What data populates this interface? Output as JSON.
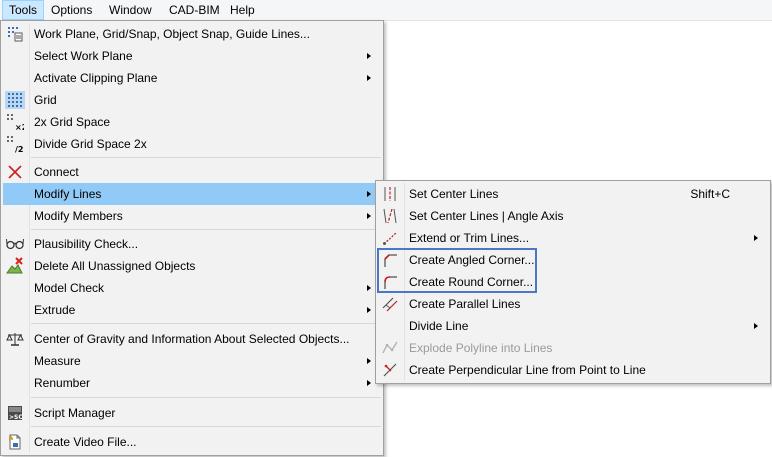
{
  "menubar": {
    "items": [
      "Tools",
      "Options",
      "Window",
      "CAD-BIM",
      "Help"
    ]
  },
  "tools_menu": {
    "items": [
      {
        "label": "Work Plane, Grid/Snap, Object Snap, Guide Lines...",
        "icon": "grid-settings-icon",
        "submenu": false
      },
      {
        "label": "Select Work Plane",
        "icon": "",
        "submenu": true
      },
      {
        "label": "Activate Clipping Plane",
        "icon": "",
        "submenu": true
      },
      {
        "label": "Grid",
        "icon": "grid-icon",
        "submenu": false
      },
      {
        "label": "2x Grid Space",
        "icon": "grid-space-2x-icon",
        "submenu": false
      },
      {
        "label": "Divide Grid Space 2x",
        "icon": "divide-grid-space-icon",
        "submenu": false
      },
      {
        "label": "Connect",
        "icon": "connect-icon",
        "submenu": false
      },
      {
        "label": "Modify Lines",
        "icon": "",
        "submenu": true
      },
      {
        "label": "Modify Members",
        "icon": "",
        "submenu": true
      },
      {
        "label": "Plausibility Check...",
        "icon": "glasses-icon",
        "submenu": false
      },
      {
        "label": "Delete All Unassigned Objects",
        "icon": "delete-objects-icon",
        "submenu": false
      },
      {
        "label": "Model Check",
        "icon": "",
        "submenu": true
      },
      {
        "label": "Extrude",
        "icon": "",
        "submenu": true
      },
      {
        "label": "Center of Gravity and Information About Selected Objects...",
        "icon": "scale-icon",
        "submenu": false
      },
      {
        "label": "Measure",
        "icon": "",
        "submenu": true
      },
      {
        "label": "Renumber",
        "icon": "",
        "submenu": true
      },
      {
        "label": "Script Manager",
        "icon": "script-manager-icon",
        "submenu": false
      },
      {
        "label": "Create Video File...",
        "icon": "video-file-icon",
        "submenu": false
      }
    ]
  },
  "modify_lines_menu": {
    "items": [
      {
        "label": "Set Center Lines",
        "icon": "center-lines-icon",
        "shortcut": "Shift+C",
        "submenu": false
      },
      {
        "label": "Set Center Lines | Angle Axis",
        "icon": "center-lines-angle-icon",
        "shortcut": "",
        "submenu": false
      },
      {
        "label": "Extend or Trim Lines...",
        "icon": "extend-trim-icon",
        "shortcut": "",
        "submenu": true
      },
      {
        "label": "Create Angled Corner...",
        "icon": "angled-corner-icon",
        "shortcut": "",
        "submenu": false
      },
      {
        "label": "Create Round Corner...",
        "icon": "round-corner-icon",
        "shortcut": "",
        "submenu": false
      },
      {
        "label": "Create Parallel Lines",
        "icon": "parallel-lines-icon",
        "shortcut": "",
        "submenu": false
      },
      {
        "label": "Divide Line",
        "icon": "",
        "shortcut": "",
        "submenu": true
      },
      {
        "label": "Explode Polyline into Lines",
        "icon": "explode-polyline-icon",
        "shortcut": "",
        "submenu": false,
        "disabled": true
      },
      {
        "label": "Create Perpendicular Line from Point to Line",
        "icon": "perpendicular-line-icon",
        "shortcut": "",
        "submenu": false
      }
    ]
  },
  "colors": {
    "highlight": "#91c9f7",
    "callout_border": "#4a78c8",
    "menu_bg": "#f2f2f2"
  }
}
